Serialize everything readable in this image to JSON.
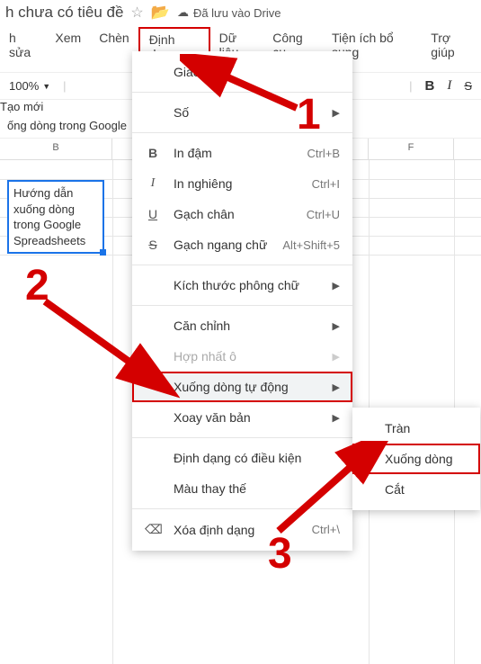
{
  "title_bar": {
    "doc_title": "h chưa có tiêu đề",
    "drive_status": "Đã lưu vào Drive"
  },
  "menu": {
    "edit": "h sửa",
    "view": "Xem",
    "insert": "Chèn",
    "format": "Định dạng",
    "data": "Dữ liệu",
    "tools": "Công cụ",
    "addons": "Tiện ích bổ sung",
    "help": "Trợ giúp"
  },
  "toolbar": {
    "zoom": "100%",
    "new_btn": "Tạo mới",
    "bold": "B",
    "italic": "I"
  },
  "formula_bar": "ống dòng trong Google",
  "columns": {
    "b": "B",
    "f": "F"
  },
  "cell_text": "Hướng dẫn xuống dòng trong Google Spreadsheets",
  "dropdown": {
    "theme": "Giao diện",
    "number": "Số",
    "bold": "In đậm",
    "bold_sc": "Ctrl+B",
    "italic": "In nghiêng",
    "italic_sc": "Ctrl+I",
    "underline": "Gạch chân",
    "underline_sc": "Ctrl+U",
    "strike": "Gạch ngang chữ",
    "strike_sc": "Alt+Shift+5",
    "fontsize": "Kích thước phông chữ",
    "align": "Căn chỉnh",
    "merge": "Hợp nhất ô",
    "wrap": "Xuống dòng tự động",
    "rotation": "Xoay văn bản",
    "conditional": "Định dạng có điều kiện",
    "alternating": "Màu thay thế",
    "clear": "Xóa định dạng",
    "clear_sc": "Ctrl+\\"
  },
  "submenu": {
    "overflow": "Tràn",
    "wrap": "Xuống dòng",
    "clip": "Cắt"
  },
  "annotations": {
    "n1": "1",
    "n2": "2",
    "n3": "3"
  }
}
